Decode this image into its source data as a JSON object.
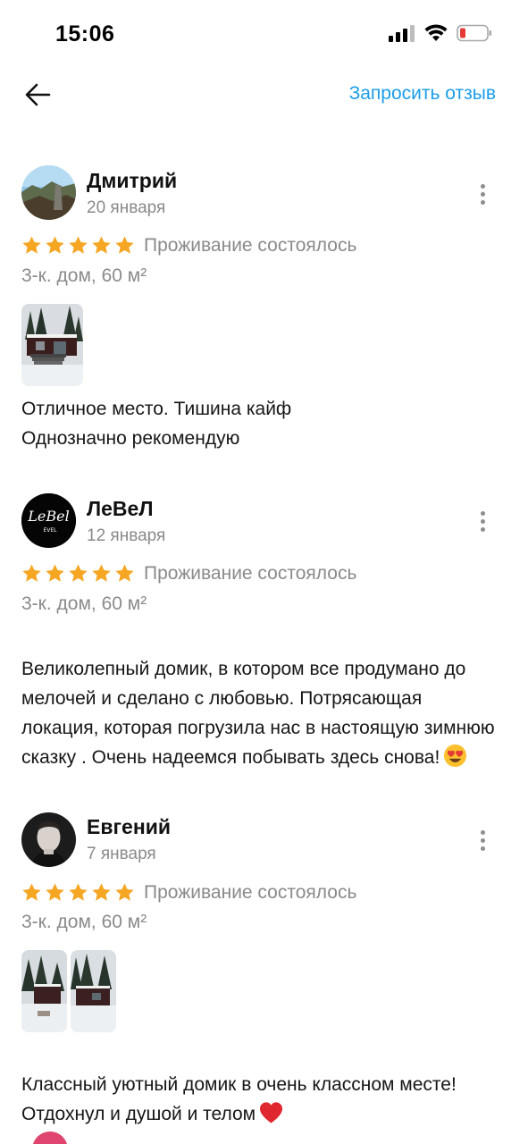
{
  "status_bar": {
    "time": "15:06"
  },
  "header": {
    "request_review_label": "Запросить отзыв"
  },
  "reviews": [
    {
      "author": "Дмитрий",
      "date": "20 января",
      "rating": 5,
      "stay_status": "Проживание состоялось",
      "property": "3-к. дом, 60 м²",
      "photos": 1,
      "text": "Отличное место. Тишина кайф\nОднозначно рекомендую"
    },
    {
      "author": "ЛеВеЛ",
      "date": "12 января",
      "rating": 5,
      "stay_status": "Проживание состоялось",
      "property": "3-к. дом, 60 м²",
      "photos": 0,
      "text": "Великолепный домик, в котором все продумано до мелочей и сделано с любовью. Потрясающая локация, которая погрузила нас в настоящую зимнюю сказку . Очень надеемся побывать здесь снова!",
      "emoji": "heart-eyes-emoji-icon",
      "avatar_logo_text": "LeBel",
      "avatar_logo_sub": "EVEL"
    },
    {
      "author": "Евгений",
      "date": "7 января",
      "rating": 5,
      "stay_status": "Проживание состоялось",
      "property": "3-к. дом, 60 м²",
      "photos": 2,
      "text": "Классный уютный домик в очень классном месте! Отдохнул и душой и телом",
      "emoji": "red-heart-emoji-icon"
    }
  ],
  "colors": {
    "accent": "#1a9ee8",
    "star": "#f5a623",
    "muted_text": "#8a8a8a",
    "battery_low": "#e53935"
  }
}
